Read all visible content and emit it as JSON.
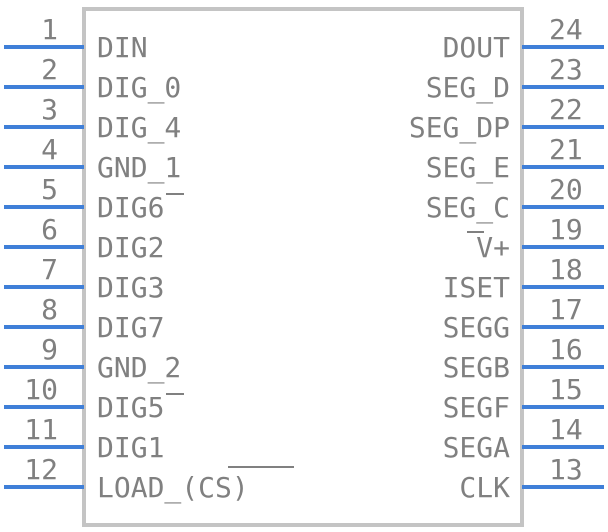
{
  "component": {
    "left_pins": [
      {
        "number": "1",
        "name": "DIN"
      },
      {
        "number": "2",
        "name": "DIG_0"
      },
      {
        "number": "3",
        "name": "DIG_4"
      },
      {
        "number": "4",
        "name": "GND_1"
      },
      {
        "number": "5",
        "name": "DIG6"
      },
      {
        "number": "6",
        "name": "DIG2"
      },
      {
        "number": "7",
        "name": "DIG3"
      },
      {
        "number": "8",
        "name": "DIG7"
      },
      {
        "number": "9",
        "name": "GND_2"
      },
      {
        "number": "10",
        "name": "DIG5"
      },
      {
        "number": "11",
        "name": "DIG1"
      },
      {
        "number": "12",
        "name": "LOAD_(CS)"
      }
    ],
    "right_pins": [
      {
        "number": "24",
        "name": "DOUT"
      },
      {
        "number": "23",
        "name": "SEG_D"
      },
      {
        "number": "22",
        "name": "SEG_DP"
      },
      {
        "number": "21",
        "name": "SEG_E"
      },
      {
        "number": "20",
        "name": "SEG_C"
      },
      {
        "number": "19",
        "name": "V+"
      },
      {
        "number": "18",
        "name": "ISET"
      },
      {
        "number": "17",
        "name": "SEGG"
      },
      {
        "number": "16",
        "name": "SEGB"
      },
      {
        "number": "15",
        "name": "SEGF"
      },
      {
        "number": "14",
        "name": "SEGA"
      },
      {
        "number": "13",
        "name": "CLK"
      }
    ]
  },
  "colors": {
    "pin_line": "#3f7fd8",
    "body_outline": "#c4c4c4",
    "text": "#808080"
  }
}
